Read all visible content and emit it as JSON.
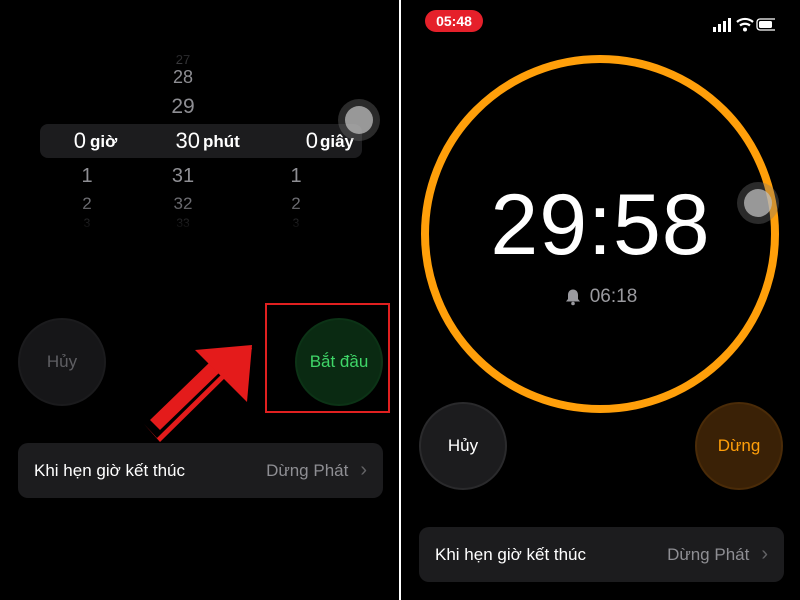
{
  "left": {
    "picker": {
      "hours": {
        "unit": "giờ",
        "selected": "0",
        "below": [
          "1",
          "2",
          "3"
        ]
      },
      "minutes": {
        "unit": "phút",
        "above": [
          "27",
          "28",
          "29"
        ],
        "selected": "30",
        "below": [
          "31",
          "32",
          "33"
        ]
      },
      "seconds": {
        "unit": "giây",
        "selected": "0",
        "below": [
          "1",
          "2",
          "3"
        ]
      }
    },
    "cancel_label": "Hủy",
    "start_label": "Bắt đầu",
    "when_timer_ends": {
      "label": "Khi hẹn giờ kết thúc",
      "value": "Dừng Phát"
    }
  },
  "right": {
    "status_time": "05:48",
    "countdown": "29:58",
    "alarm_time": "06:18",
    "cancel_label": "Hủy",
    "stop_label": "Dừng",
    "when_timer_ends": {
      "label": "Khi hẹn giờ kết thúc",
      "value": "Dừng Phát"
    }
  },
  "colors": {
    "ring": "#ff9f0a",
    "start_green": "#3fd668",
    "stop_orange": "#ff9f0a",
    "highlight_red": "#e02020",
    "status_red": "#e5202a"
  },
  "icons": [
    "arrow-pointer-icon",
    "bell-icon",
    "chevron-right-icon",
    "signal-icon",
    "wifi-icon",
    "battery-icon",
    "assistive-touch-icon"
  ]
}
